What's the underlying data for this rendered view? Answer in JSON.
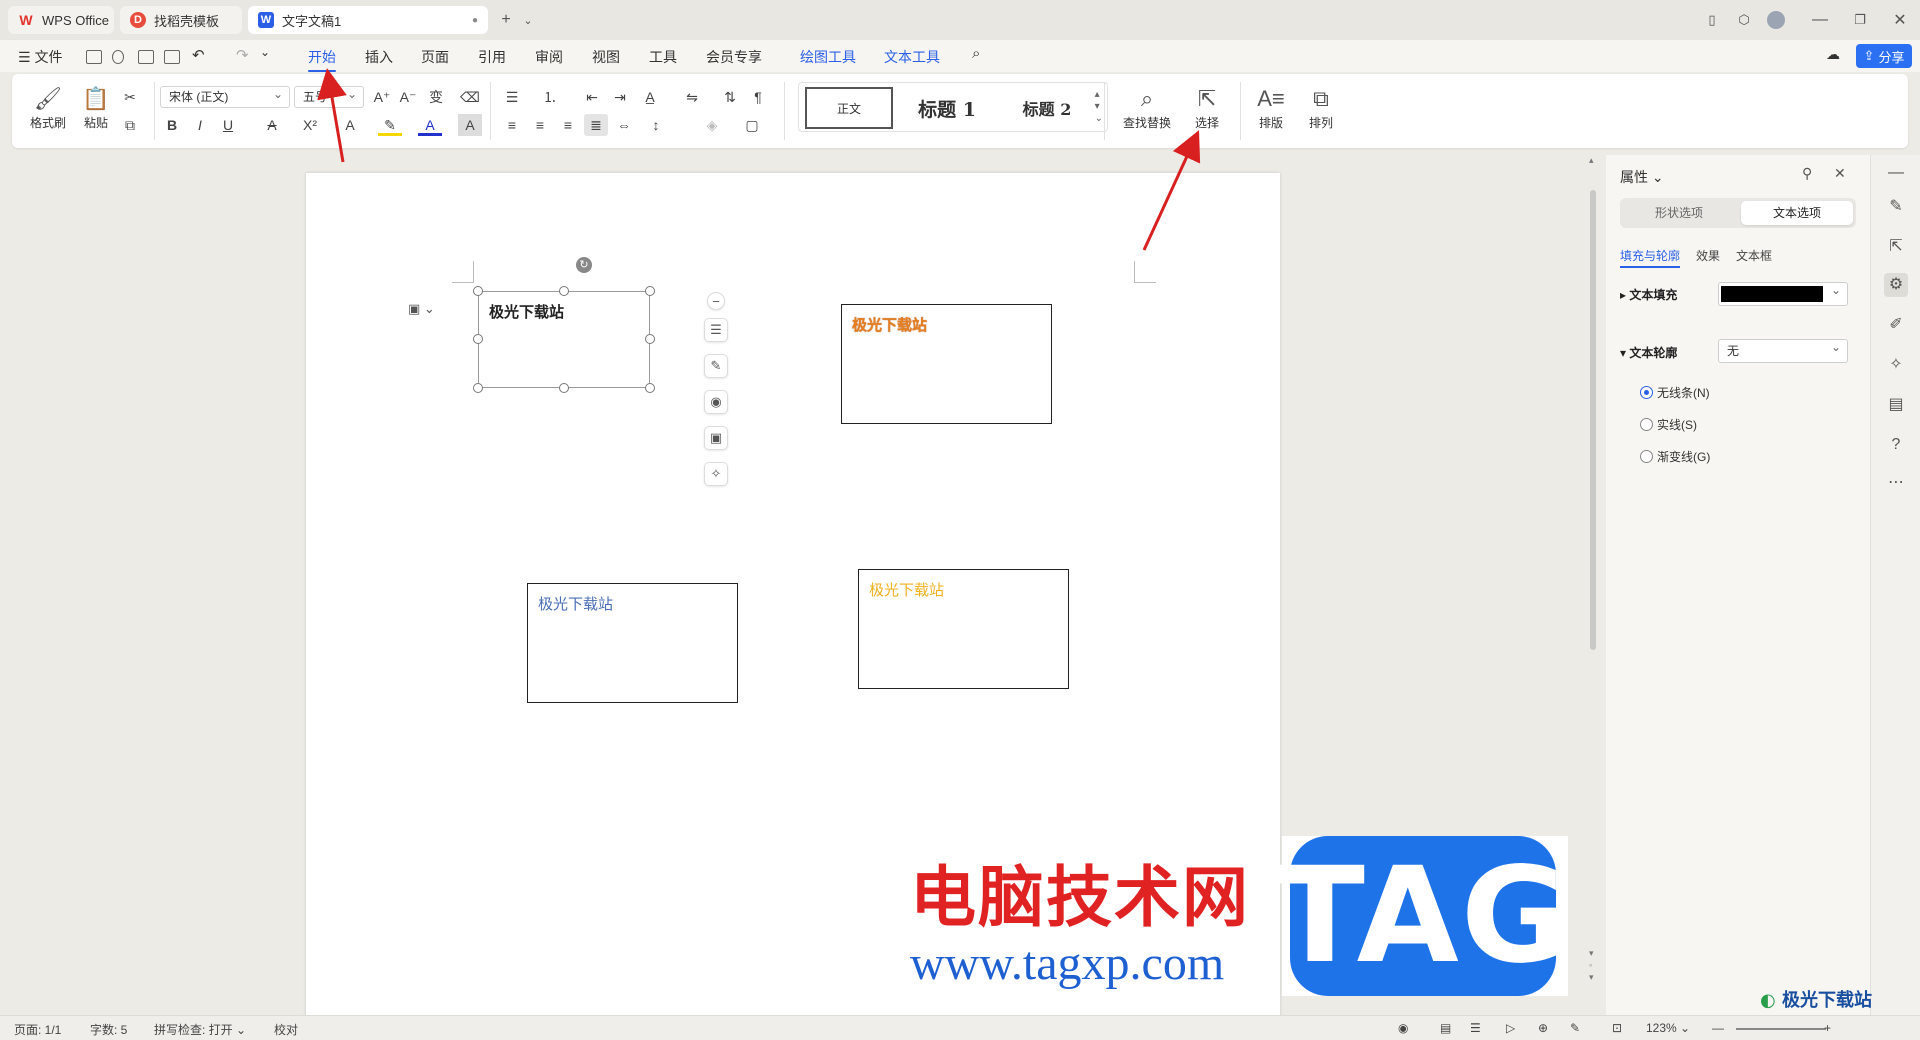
{
  "tabs": [
    {
      "label": "WPS Office",
      "icon": "wps-logo-icon"
    },
    {
      "label": "找稻壳模板",
      "icon": "docer-icon"
    },
    {
      "label": "文字文稿1",
      "icon": "writer-icon"
    }
  ],
  "menu": {
    "file": "文件",
    "items": [
      "开始",
      "插入",
      "页面",
      "引用",
      "审阅",
      "视图",
      "工具",
      "会员专享",
      "绘图工具",
      "文本工具"
    ],
    "active": "开始",
    "share": "分享"
  },
  "ribbon": {
    "format_painter": "格式刷",
    "paste": "粘贴",
    "font_name": "宋体 (正文)",
    "font_size": "五号",
    "styles": {
      "normal": "正文",
      "h1": "标题 1",
      "h2": "标题 2"
    },
    "find_replace": "查找替换",
    "select": "选择",
    "typeset": "排版",
    "arrange": "排列"
  },
  "document": {
    "textboxes": [
      {
        "text": "极光下载站",
        "color": "#222222"
      },
      {
        "text": "极光下载站",
        "color": "#e67e22"
      },
      {
        "text": "极光下载站",
        "color": "#4a6fb5"
      },
      {
        "text": "极光下载站",
        "color": "#f0b020"
      }
    ]
  },
  "watermark": {
    "site_name": "电脑技术网",
    "url": "www.tagxp.com",
    "logo_text": "TAG",
    "corner_text": "极光下载站"
  },
  "properties": {
    "title": "属性",
    "tabs": [
      "形状选项",
      "文本选项"
    ],
    "active_tab": "文本选项",
    "subtabs": [
      "填充与轮廓",
      "效果",
      "文本框"
    ],
    "active_subtab": "填充与轮廓",
    "text_fill_label": "文本填充",
    "text_fill_color": "#000000",
    "text_outline_label": "文本轮廓",
    "text_outline_value": "无",
    "outline_options": [
      "无线条(N)",
      "实线(S)",
      "渐变线(G)"
    ],
    "outline_selected": "无线条(N)"
  },
  "status": {
    "page": "页面: 1/1",
    "words": "字数: 5",
    "spell": "拼写检查: 打开",
    "proof": "校对",
    "zoom": "123%"
  }
}
